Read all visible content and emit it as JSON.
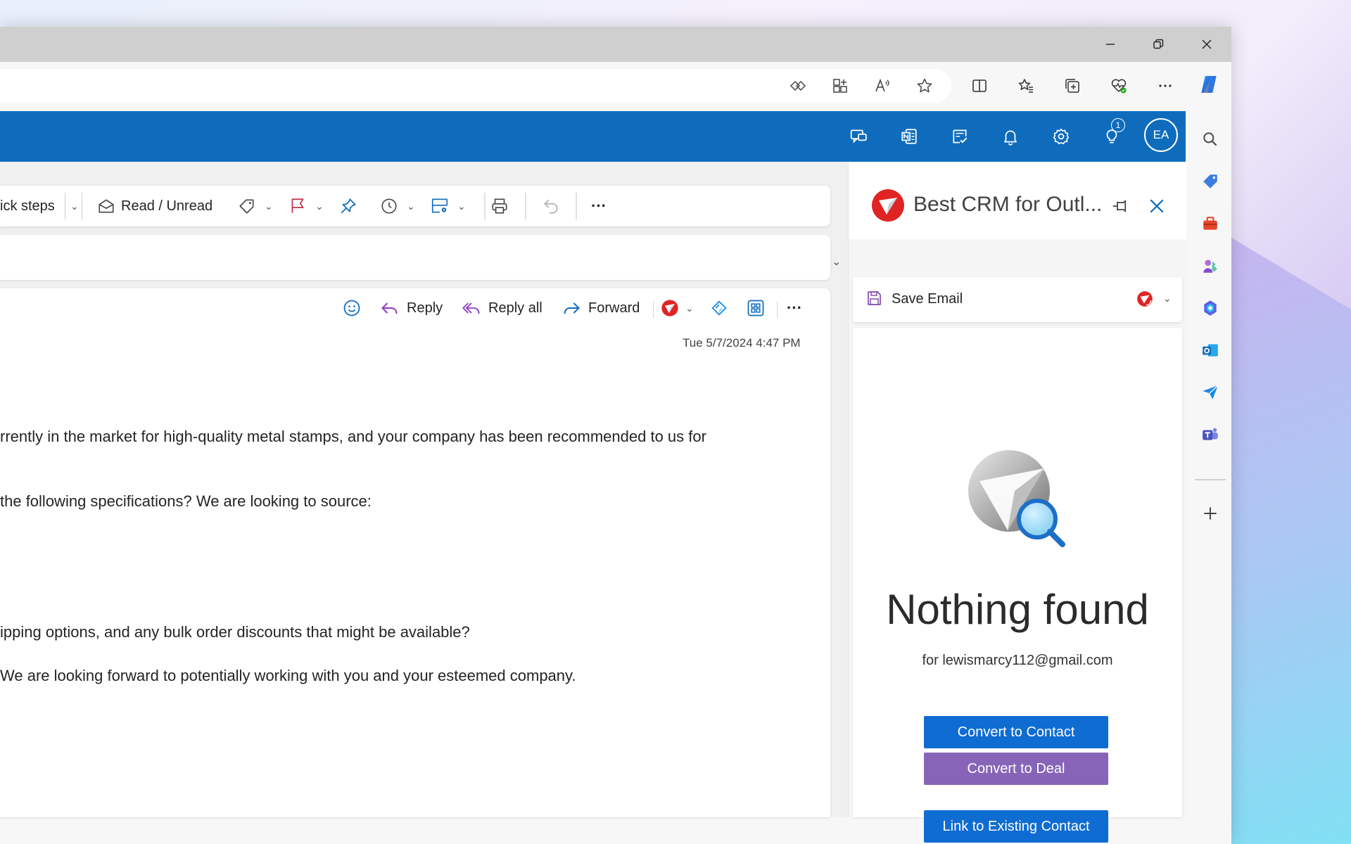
{
  "colors": {
    "outlook_blue": "#0f6cbd",
    "crm_red": "#e02424",
    "convert_contact_btn": "#0f6cd2",
    "convert_deal_btn": "#8764b8",
    "link_contact_btn": "#0f6cd2"
  },
  "browser": {
    "title_controls": [
      "minimize-icon",
      "restore-icon",
      "close-icon"
    ],
    "address_icons": [
      "reader-mode-icon",
      "app-available-icon",
      "read-aloud-icon",
      "favorite-star-icon"
    ],
    "toolbar_icons": [
      "split-screen-icon",
      "favorites-icon",
      "collections-icon",
      "browser-essentials-icon",
      "more-icon",
      "copilot-icon"
    ],
    "sidebar_icons": [
      "search-icon",
      "shopping-tag-icon",
      "tools-icon",
      "games-icon",
      "microsoft-365-icon",
      "outlook-icon",
      "send-icon",
      "teams-icon",
      "add-icon"
    ]
  },
  "outlook_header": {
    "icons": [
      "meet-now-icon",
      "onenote-icon",
      "todo-icon",
      "bell-icon",
      "settings-icon",
      "tips-icon"
    ],
    "tips_badge": "1",
    "avatar_initials": "EA"
  },
  "ribbon": {
    "quick_steps": "ick steps",
    "read_unread": "Read / Unread",
    "icons": [
      "tag-icon",
      "flag-icon",
      "pin-icon",
      "snooze-icon",
      "rules-icon",
      "print-icon",
      "undo-icon",
      "more-icon"
    ],
    "more_label": "···"
  },
  "message": {
    "actions": {
      "reply": "Reply",
      "reply_all": "Reply all",
      "forward": "Forward",
      "more_label": "···"
    },
    "timestamp": "Tue 5/7/2024 4:47 PM",
    "body_lines": [
      "rrently in the market for high-quality metal stamps, and your company has been recommended to us for",
      " the following specifications? We are looking to source:",
      "ipping options, and any bulk order discounts that might be available?",
      "We are looking forward to potentially working with you and your esteemed company."
    ]
  },
  "crm": {
    "title": "Best CRM for Outl...",
    "save_email": "Save Email",
    "nothing_found": "Nothing found",
    "for_email": "for lewismarcy112@gmail.com",
    "buttons": {
      "convert_contact": "Convert to Contact",
      "convert_deal": "Convert to Deal",
      "link_contact": "Link to Existing Contact"
    }
  }
}
